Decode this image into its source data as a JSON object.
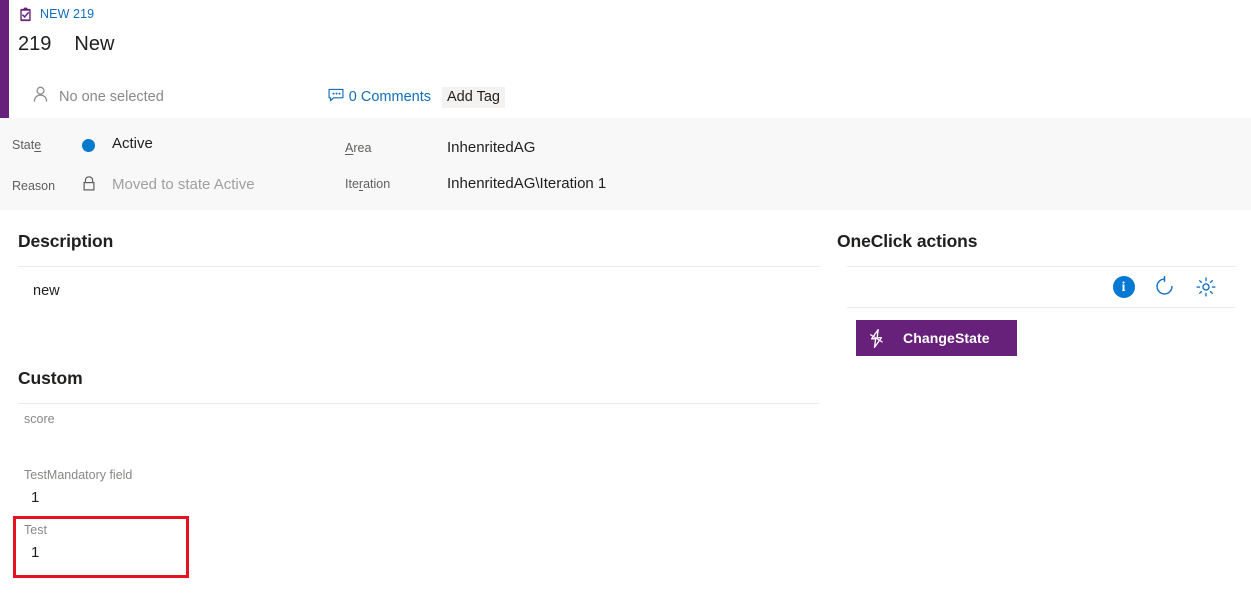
{
  "accent_color": "#68217a",
  "breadcrumb": {
    "icon": "task-workitem-icon",
    "label": "NEW 219"
  },
  "header": {
    "work_item_id": "219",
    "work_item_title": "New"
  },
  "meta": {
    "assignee_icon": "person-icon",
    "assignee_text": "No one selected",
    "comments_icon": "comment-bubble-icon",
    "comments_label": "0 Comments",
    "add_tag_label_prefix": "Add Ta",
    "add_tag_label_accesskey": "g"
  },
  "fields": {
    "state": {
      "label_prefix": "Stat",
      "label_accesskey": "e",
      "value": "Active",
      "dot_color": "#007acc"
    },
    "reason": {
      "label": "Reason",
      "icon": "lock-icon",
      "value": "Moved to state Active"
    },
    "area": {
      "label_accesskey": "A",
      "label_suffix": "rea",
      "value": "InhenritedAG"
    },
    "iteration": {
      "label_prefix": "Ite",
      "label_accesskey": "r",
      "label_suffix": "ation",
      "value": "InhenritedAG\\Iteration 1"
    }
  },
  "description": {
    "heading": "Description",
    "body": "new"
  },
  "custom": {
    "heading": "Custom",
    "fields": [
      {
        "label": "score",
        "value": ""
      },
      {
        "label": "TestMandatory field",
        "value": "1"
      },
      {
        "label": "Test",
        "value": "1"
      }
    ]
  },
  "oneclick": {
    "heading": "OneClick actions",
    "toolbar": [
      {
        "name": "info-icon",
        "glyph": "i"
      },
      {
        "name": "refresh-icon",
        "glyph": ""
      },
      {
        "name": "settings-gear-icon",
        "glyph": ""
      }
    ],
    "action_button": {
      "icon": "lightning-bolt-icon",
      "label": "ChangeState",
      "color": "#68217a"
    }
  },
  "highlight": {
    "color": "#e81123"
  }
}
